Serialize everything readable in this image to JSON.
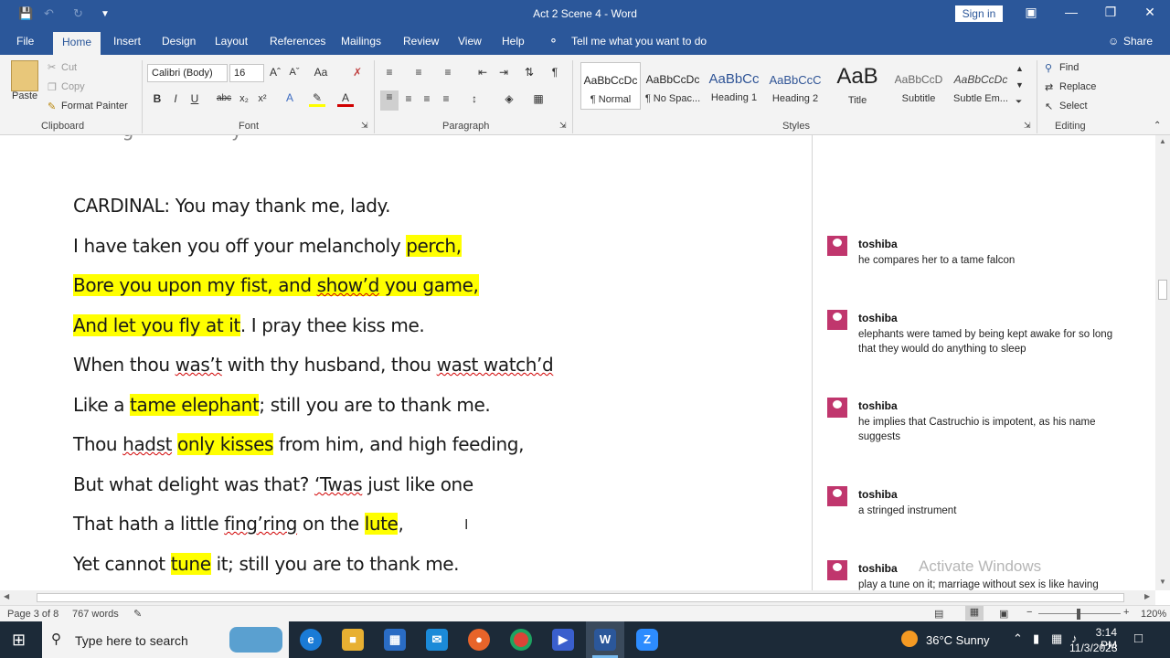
{
  "titlebar": {
    "title": "Act 2 Scene 4  -  Word",
    "signin": "Sign in"
  },
  "tabs": [
    "File",
    "Home",
    "Insert",
    "Design",
    "Layout",
    "References",
    "Mailings",
    "Review",
    "View",
    "Help"
  ],
  "tell_me": "Tell me what you want to do",
  "share": "Share",
  "clipboard": {
    "paste": "Paste",
    "cut": "Cut",
    "copy": "Copy",
    "format_painter": "Format Painter",
    "label": "Clipboard"
  },
  "font": {
    "name": "Calibri (Body)",
    "size": "16",
    "label": "Font",
    "bold": "B",
    "italic": "I",
    "underline": "U",
    "strike": "abc"
  },
  "paragraph": {
    "label": "Paragraph"
  },
  "styles": {
    "label": "Styles",
    "items": [
      {
        "sample": "AaBbCcDc",
        "name": "¶ Normal"
      },
      {
        "sample": "AaBbCcDc",
        "name": "¶ No Spac..."
      },
      {
        "sample": "AaBbCc",
        "name": "Heading 1"
      },
      {
        "sample": "AaBbCcC",
        "name": "Heading 2"
      },
      {
        "sample": "AaB",
        "name": "Title"
      },
      {
        "sample": "AaBbCcD",
        "name": "Subtitle"
      },
      {
        "sample": "AaBbCcDc",
        "name": "Subtle Em..."
      }
    ]
  },
  "editing": {
    "find": "Find",
    "replace": "Replace",
    "select": "Select",
    "label": "Editing"
  },
  "document": {
    "lines": [
      "CARDINAL: You may thank me, lady.",
      "I have taken you off your melancholy perch,",
      "Bore you upon my fist, and show’d you game,",
      "And let you fly at it. I pray thee kiss me.",
      "When thou was’t with thy husband, thou wast watch’d",
      "Like a tame elephant; still you are to thank me.",
      "Thou hadst only kisses from him, and high feeding,",
      "But what delight was that? ‘Twas just like one",
      "That hath a little fing’ring on the lute,",
      "Yet cannot tune it; still you are to thank me."
    ]
  },
  "comments": [
    {
      "author": "toshiba",
      "text": "he compares her to a tame falcon"
    },
    {
      "author": "toshiba",
      "text": "elephants were tamed by being kept awake for so long that they would do anything to sleep"
    },
    {
      "author": "toshiba",
      "text": "he implies that Castruchio is impotent, as his name suggests"
    },
    {
      "author": "toshiba",
      "text": "a stringed instrument"
    },
    {
      "author": "toshiba",
      "text": "play a tune on it; marriage without sex is like having"
    }
  ],
  "watermark": "Activate Windows",
  "status": {
    "page": "Page 3 of 8",
    "words": "767 words",
    "zoom": "120%"
  },
  "taskbar": {
    "search_placeholder": "Type here to search",
    "weather": "36°C  Sunny",
    "time": "3:14 PM",
    "date": "11/3/2023"
  }
}
